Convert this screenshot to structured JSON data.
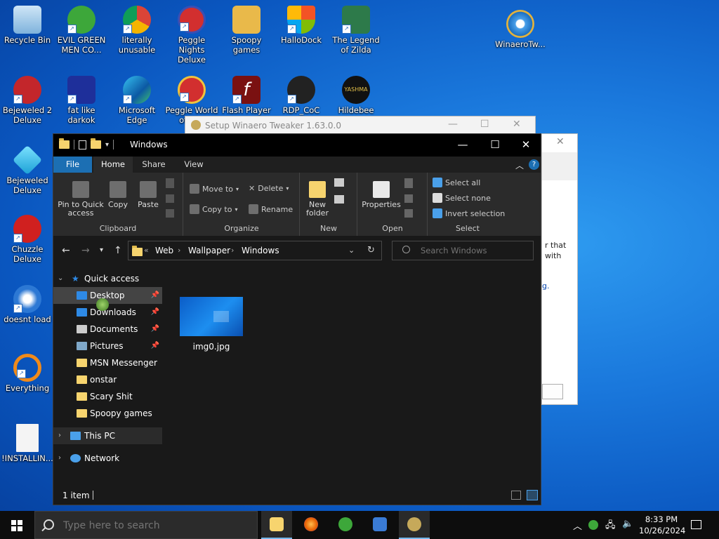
{
  "desktop": {
    "icons": [
      {
        "label": "Recycle Bin"
      },
      {
        "label": "EVIL GREEN MEN CO..."
      },
      {
        "label": "literally unusable"
      },
      {
        "label": "Peggle Nights Deluxe"
      },
      {
        "label": "Spoopy games"
      },
      {
        "label": "HalloDock"
      },
      {
        "label": "The Legend of Zilda"
      },
      {
        "label": "WinaeroTw..."
      },
      {
        "label": "Bejeweled 2 Deluxe"
      },
      {
        "label": "fat like darkok"
      },
      {
        "label": "Microsoft Edge"
      },
      {
        "label": "Peggle World of W..."
      },
      {
        "label": "Flash Player"
      },
      {
        "label": "RDP_CoC"
      },
      {
        "label": "Hildebee"
      },
      {
        "label": "Bejeweled Deluxe"
      },
      {
        "label": "Chuzzle Deluxe"
      },
      {
        "label": "doesnt load"
      },
      {
        "label": "Everything"
      },
      {
        "label": "!INSTALLIN..."
      }
    ]
  },
  "setup_window": {
    "title": "Setup Winaero Tweaker 1.63.0.0",
    "text_line1": "r that",
    "text_line2": "with",
    "link": "g."
  },
  "explorer": {
    "title": "Windows",
    "tabs": {
      "file": "File",
      "home": "Home",
      "share": "Share",
      "view": "View"
    },
    "clipboard": {
      "pin": "Pin to Quick access",
      "copy": "Copy",
      "paste": "Paste",
      "group": "Clipboard"
    },
    "organize": {
      "move_to": "Move to",
      "copy_to": "Copy to",
      "delete": "Delete",
      "rename": "Rename",
      "group": "Organize"
    },
    "new": {
      "new_folder": "New folder",
      "group": "New"
    },
    "open": {
      "properties": "Properties",
      "group": "Open"
    },
    "select": {
      "select_all": "Select all",
      "select_none": "Select none",
      "invert": "Invert selection",
      "group": "Select"
    },
    "address": {
      "crumbs": [
        "Web",
        "Wallpaper",
        "Windows"
      ],
      "overflow": "«"
    },
    "search_placeholder": "Search Windows",
    "nav": {
      "quick_access": "Quick access",
      "items": [
        {
          "label": "Desktop"
        },
        {
          "label": "Downloads"
        },
        {
          "label": "Documents"
        },
        {
          "label": "Pictures"
        },
        {
          "label": "MSN Messenger"
        },
        {
          "label": "onstar"
        },
        {
          "label": "Scary Shit"
        },
        {
          "label": "Spoopy games"
        }
      ],
      "this_pc": "This PC",
      "network": "Network"
    },
    "files": [
      {
        "name": "img0.jpg"
      }
    ],
    "status": "1 item"
  },
  "taskbar": {
    "search_placeholder": "Type here to search",
    "time": "8:33 PM",
    "date": "10/26/2024"
  },
  "colors": {
    "accent": "#1c6fb3",
    "folder": "#f7d46e"
  }
}
